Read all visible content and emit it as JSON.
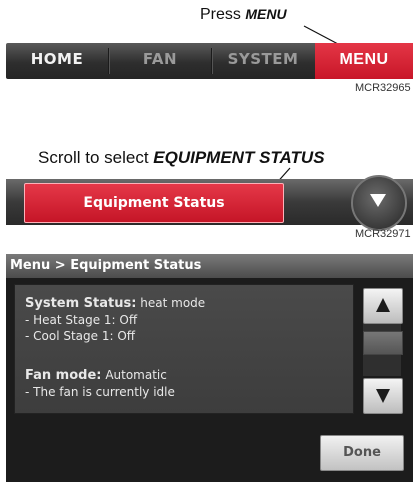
{
  "panel1": {
    "caption_prefix": "Press",
    "caption_bold": "MENU",
    "nav": {
      "home": "HOME",
      "fan": "FAN",
      "system": "SYSTEM",
      "menu": "MENU"
    },
    "code": "MCR32965"
  },
  "panel2": {
    "caption_prefix": "Scroll to select",
    "caption_bold": "EQUIPMENT STATUS",
    "button": "Equipment Status",
    "arrow_icon": "chevron-down-icon",
    "code": "MCR32971"
  },
  "panel3": {
    "title": "Menu > Equipment Status",
    "system_label": "System Status:",
    "system_value": "heat mode",
    "heat_stage": "- Heat Stage 1: Off",
    "cool_stage": "- Cool Stage 1: Off",
    "fan_label": "Fan mode:",
    "fan_value": "Automatic",
    "fan_status": "- The fan is currently idle",
    "done": "Done",
    "scroll_up_icon": "arrow-up-icon",
    "scroll_down_icon": "arrow-down-icon"
  },
  "colors": {
    "accent_red": "#d0202f",
    "bar_dark": "#2e2e2e",
    "screen_bg": "#1c1c1c"
  }
}
